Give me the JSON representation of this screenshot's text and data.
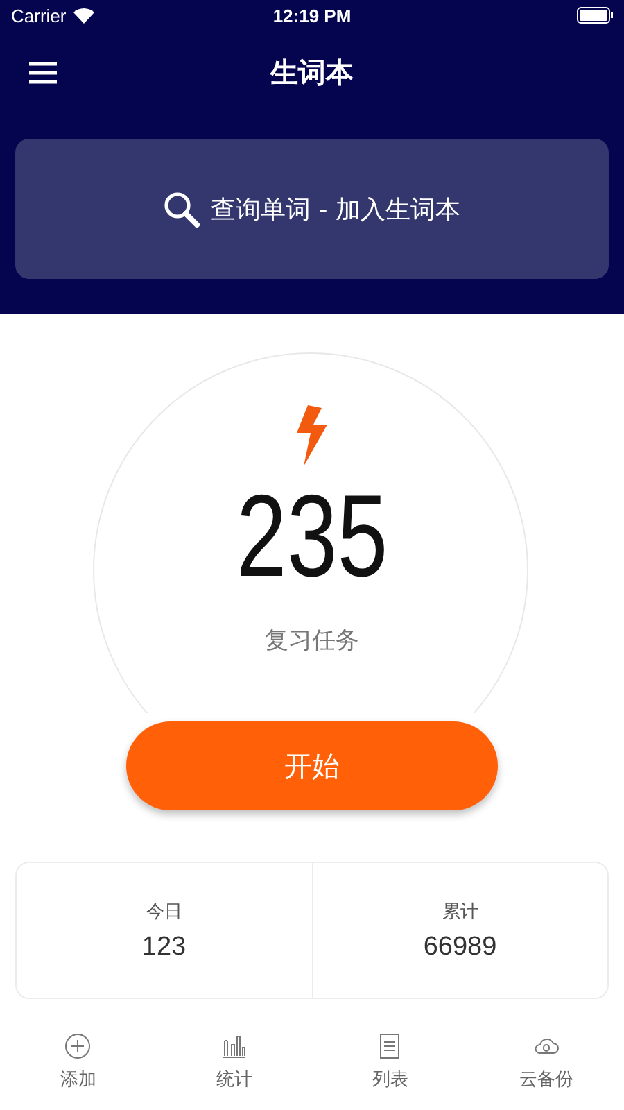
{
  "status_bar": {
    "carrier": "Carrier",
    "time": "12:19 PM"
  },
  "nav": {
    "title": "生词本"
  },
  "search": {
    "label": "查询单词 - 加入生词本"
  },
  "review": {
    "count": "235",
    "label": "复习任务",
    "start": "开始"
  },
  "stats": [
    {
      "label": "今日",
      "value": "123"
    },
    {
      "label": "累计",
      "value": "66989"
    }
  ],
  "tab_bar": [
    {
      "kind": "add",
      "label": "添加"
    },
    {
      "kind": "stats",
      "label": "统计"
    },
    {
      "kind": "list",
      "label": "列表"
    },
    {
      "kind": "cloud",
      "label": "云备份"
    }
  ]
}
